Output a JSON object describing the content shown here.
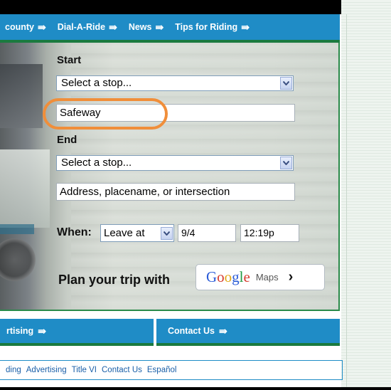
{
  "topnav": {
    "items": [
      {
        "label": "county",
        "arrow": "⇛"
      },
      {
        "label": "Dial-A-Ride",
        "arrow": "⇛"
      },
      {
        "label": "News",
        "arrow": "⇛"
      },
      {
        "label": "Tips for Riding",
        "arrow": "⇛"
      }
    ]
  },
  "planner": {
    "start_label": "Start",
    "start_select": "Select a stop...",
    "start_input": "Safeway",
    "end_label": "End",
    "end_select": "Select a stop...",
    "end_input_placeholder": "Address, placename, or intersection",
    "when_label": "When:",
    "when_mode": "Leave at",
    "date": "9/4",
    "time": "12:19p",
    "plan_text": "Plan your trip with",
    "google_logo": "Google",
    "maps_label": "Maps",
    "maps_chevron": "›"
  },
  "bottomnav": {
    "left_label": "rtising",
    "right_label": "Contact Us",
    "arrow": "⇛"
  },
  "footer": {
    "links": [
      "ding",
      "Advertising",
      "Title VI",
      "Contact Us",
      "Español"
    ]
  },
  "colors": {
    "nav_blue": "#1f8cc6",
    "accent_green": "#1a7a3f",
    "highlight_orange": "#f08e3a",
    "link_blue": "#1a5fa8"
  },
  "google_letter_colors": [
    "#2a5bd7",
    "#d63b2f",
    "#e3a818",
    "#2a5bd7",
    "#1f9a42",
    "#d63b2f"
  ]
}
